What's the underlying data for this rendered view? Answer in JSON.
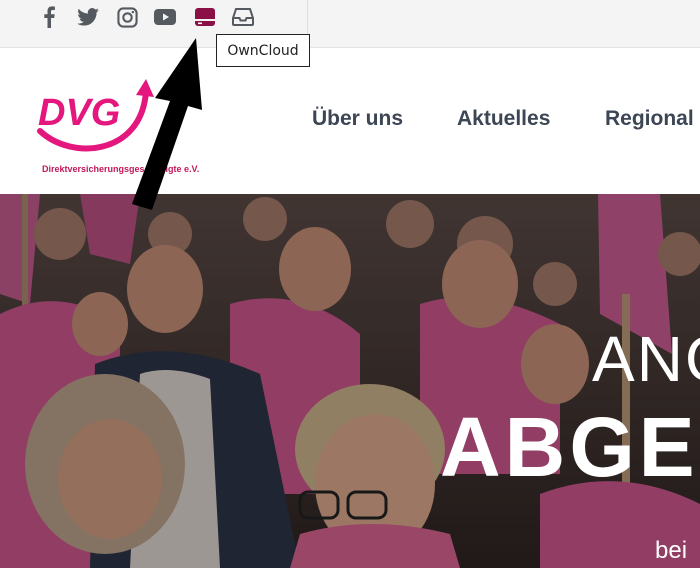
{
  "topbar": {
    "icons": [
      {
        "name": "facebook-icon"
      },
      {
        "name": "twitter-icon"
      },
      {
        "name": "instagram-icon"
      },
      {
        "name": "youtube-icon"
      },
      {
        "name": "owncloud-icon",
        "color": "#8b1045"
      },
      {
        "name": "inbox-icon"
      }
    ],
    "tooltip": "OwnCloud"
  },
  "logo": {
    "text": "DVG",
    "tagline": "Direktversicherungsgeschädigte e.V.",
    "color": "#e4177e"
  },
  "nav": {
    "items": [
      {
        "label": "Über uns"
      },
      {
        "label": "Aktuelles"
      },
      {
        "label": "Regional"
      }
    ]
  },
  "hero": {
    "line1": "ANG",
    "line2": "ABGE",
    "line3": "bei"
  },
  "colors": {
    "brand_pink": "#e4177e",
    "nav_text": "#3c4654",
    "icon_gray": "#555a60"
  }
}
